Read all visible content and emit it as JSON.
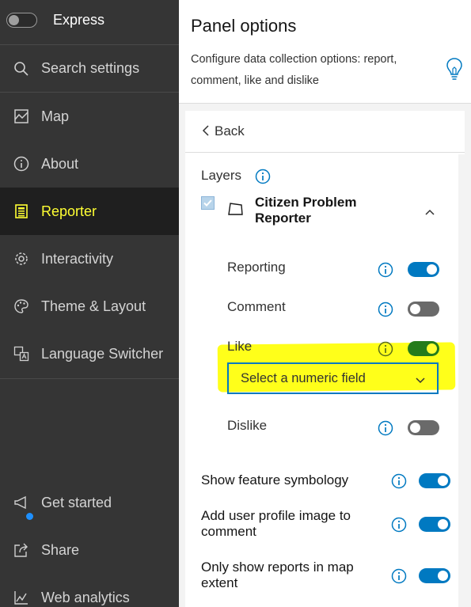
{
  "sidebar": {
    "app_name": "Express",
    "items": [
      {
        "label": "Search settings",
        "icon": "search-icon"
      },
      {
        "label": "Map",
        "icon": "map-icon"
      },
      {
        "label": "About",
        "icon": "info-icon"
      },
      {
        "label": "Reporter",
        "icon": "reporter-icon",
        "active": true
      },
      {
        "label": "Interactivity",
        "icon": "gear-icon"
      },
      {
        "label": "Theme & Layout",
        "icon": "palette-icon"
      },
      {
        "label": "Language Switcher",
        "icon": "language-icon"
      }
    ],
    "bottom_items": [
      {
        "label": "Get started",
        "icon": "megaphone-icon"
      },
      {
        "label": "Share",
        "icon": "share-icon"
      },
      {
        "label": "Web analytics",
        "icon": "analytics-icon"
      }
    ]
  },
  "header": {
    "title": "Panel options",
    "description": "Configure data collection options: report, comment, like and dislike"
  },
  "panel": {
    "back_label": "Back",
    "layers_label": "Layers",
    "layer": {
      "name": "Citizen Problem Reporter",
      "checked": true,
      "expanded": true
    },
    "options": [
      {
        "label": "Reporting",
        "state": "on"
      },
      {
        "label": "Comment",
        "state": "off"
      },
      {
        "label": "Like",
        "state": "on"
      },
      {
        "label": "Dislike",
        "state": "off"
      }
    ],
    "like_field_select": {
      "placeholder": "Select a numeric field"
    },
    "bottom_options": [
      {
        "label": "Show feature symbology",
        "state": "on"
      },
      {
        "label": "Add user profile image to comment",
        "state": "on"
      },
      {
        "label": "Only show reports in map extent",
        "state": "on"
      }
    ]
  },
  "colors": {
    "sidebar_bg": "#353535",
    "active_text": "#ffff33",
    "toggle_on": "#0079c1",
    "highlight": "#ffff1a"
  }
}
